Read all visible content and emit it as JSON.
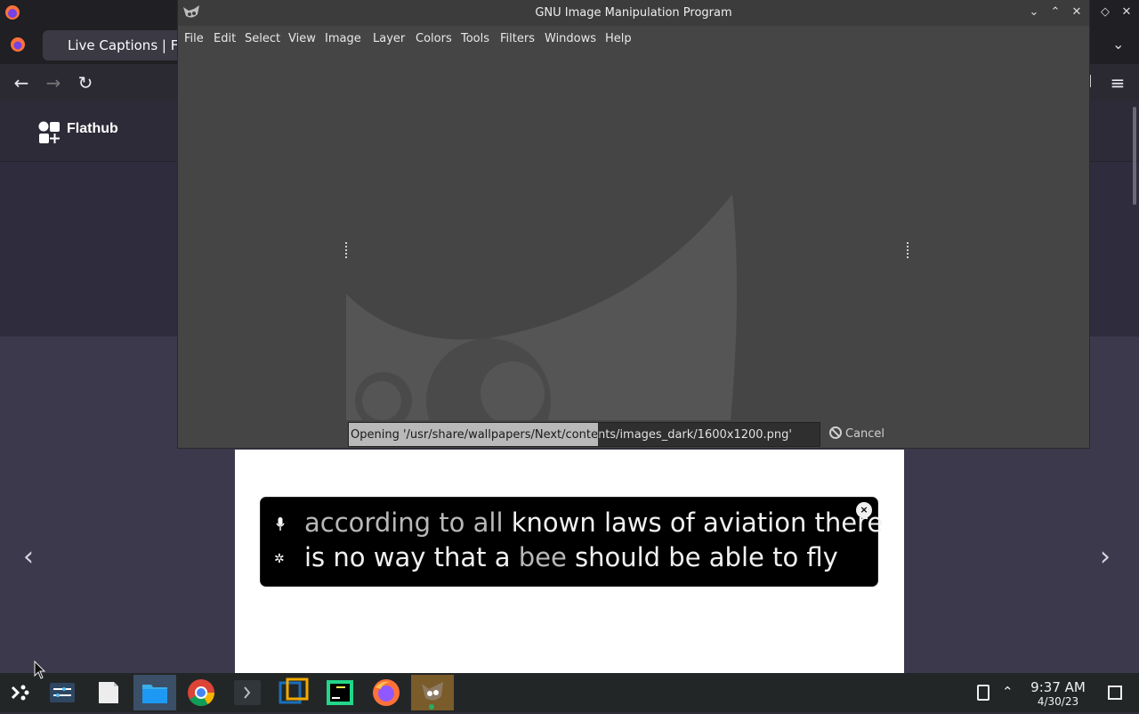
{
  "browser": {
    "tab_title": "Live Captions | Flat",
    "site_name": "Flathub",
    "header_right_fragment": "n"
  },
  "gimp": {
    "title": "GNU Image Manipulation Program",
    "menu": [
      "File",
      "Edit",
      "Select",
      "View",
      "Image",
      "Layer",
      "Colors",
      "Tools",
      "Filters",
      "Windows",
      "Help"
    ],
    "progress_text": "Opening '/usr/share/wallpapers/Next/contents/images_dark/1600x1200.png'",
    "progress_fraction": 0.53,
    "cancel_label": "Cancel"
  },
  "captions": {
    "line1_dim": "according to all",
    "line1_bright": "known laws of aviation there",
    "line2_bright_a": "is no way that a",
    "line2_dim": "bee",
    "line2_bright_b": "should be able to fly",
    "close_label": "×"
  },
  "taskbar": {
    "time": "9:37 AM",
    "date": "4/30/23",
    "apps": [
      "app-launcher",
      "system-settings",
      "text-file",
      "file-manager",
      "chrome",
      "terminal",
      "virtualbox",
      "pycharm",
      "firefox",
      "gimp"
    ]
  },
  "colors": {
    "gimp_bg": "#454545",
    "caption_bg": "#000000",
    "taskbar_bg": "#232627",
    "flathub_dark": "#2f2c3e"
  }
}
